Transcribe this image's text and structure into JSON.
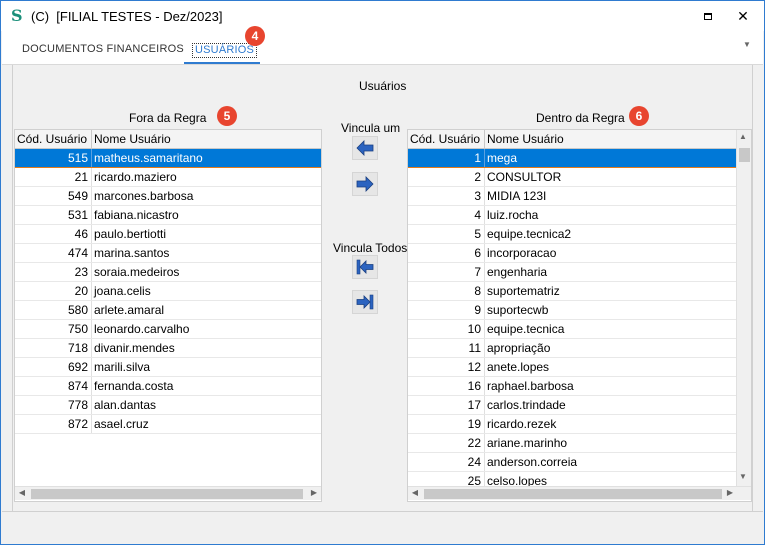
{
  "window": {
    "title": "(C)  [FILIAL TESTES - Dez/2023]",
    "close_glyph": "✕"
  },
  "tabs": [
    {
      "label": "DOCUMENTOS FINANCEIROS",
      "active": false
    },
    {
      "label": "USUÁRIOS",
      "active": true
    }
  ],
  "badges": {
    "tab_users": "4",
    "left_list": "5",
    "right_list": "6"
  },
  "panel": {
    "title": "Usuários",
    "left_title": "Fora da Regra",
    "right_title": "Dentro da Regra",
    "link_one_label": "Vincula um",
    "link_all_label": "Vincula Todos"
  },
  "columns": {
    "code": "Cód. Usuário",
    "name": "Nome Usuário"
  },
  "left_rows": [
    {
      "code": "515",
      "name": "matheus.samaritano"
    },
    {
      "code": "21",
      "name": "ricardo.maziero"
    },
    {
      "code": "549",
      "name": "marcones.barbosa"
    },
    {
      "code": "531",
      "name": "fabiana.nicastro"
    },
    {
      "code": "46",
      "name": "paulo.bertiotti"
    },
    {
      "code": "474",
      "name": "marina.santos"
    },
    {
      "code": "23",
      "name": "soraia.medeiros"
    },
    {
      "code": "20",
      "name": "joana.celis"
    },
    {
      "code": "580",
      "name": "arlete.amaral"
    },
    {
      "code": "750",
      "name": "leonardo.carvalho"
    },
    {
      "code": "718",
      "name": "divanir.mendes"
    },
    {
      "code": "692",
      "name": "marili.silva"
    },
    {
      "code": "874",
      "name": "fernanda.costa"
    },
    {
      "code": "778",
      "name": "alan.dantas"
    },
    {
      "code": "872",
      "name": "asael.cruz"
    }
  ],
  "right_rows": [
    {
      "code": "1",
      "name": "mega"
    },
    {
      "code": "2",
      "name": "CONSULTOR"
    },
    {
      "code": "3",
      "name": "MIDIA 123I"
    },
    {
      "code": "4",
      "name": "luiz.rocha"
    },
    {
      "code": "5",
      "name": "equipe.tecnica2"
    },
    {
      "code": "6",
      "name": "incorporacao"
    },
    {
      "code": "7",
      "name": "engenharia"
    },
    {
      "code": "8",
      "name": "suportematriz"
    },
    {
      "code": "9",
      "name": "suportecwb"
    },
    {
      "code": "10",
      "name": "equipe.tecnica"
    },
    {
      "code": "11",
      "name": "apropriação"
    },
    {
      "code": "12",
      "name": "anete.lopes"
    },
    {
      "code": "16",
      "name": "raphael.barbosa"
    },
    {
      "code": "17",
      "name": "carlos.trindade"
    },
    {
      "code": "19",
      "name": "ricardo.rezek"
    },
    {
      "code": "22",
      "name": "ariane.marinho"
    },
    {
      "code": "24",
      "name": "anderson.correia"
    },
    {
      "code": "25",
      "name": "celso.lopes"
    }
  ],
  "icons": {
    "move_left": "arrow-left-icon",
    "move_right": "arrow-right-icon",
    "move_all_left": "arrow-first-icon",
    "move_all_right": "arrow-last-icon"
  },
  "colors": {
    "accent": "#0078d7",
    "badge": "#e8452f",
    "tab_active": "#2f7bd0"
  }
}
